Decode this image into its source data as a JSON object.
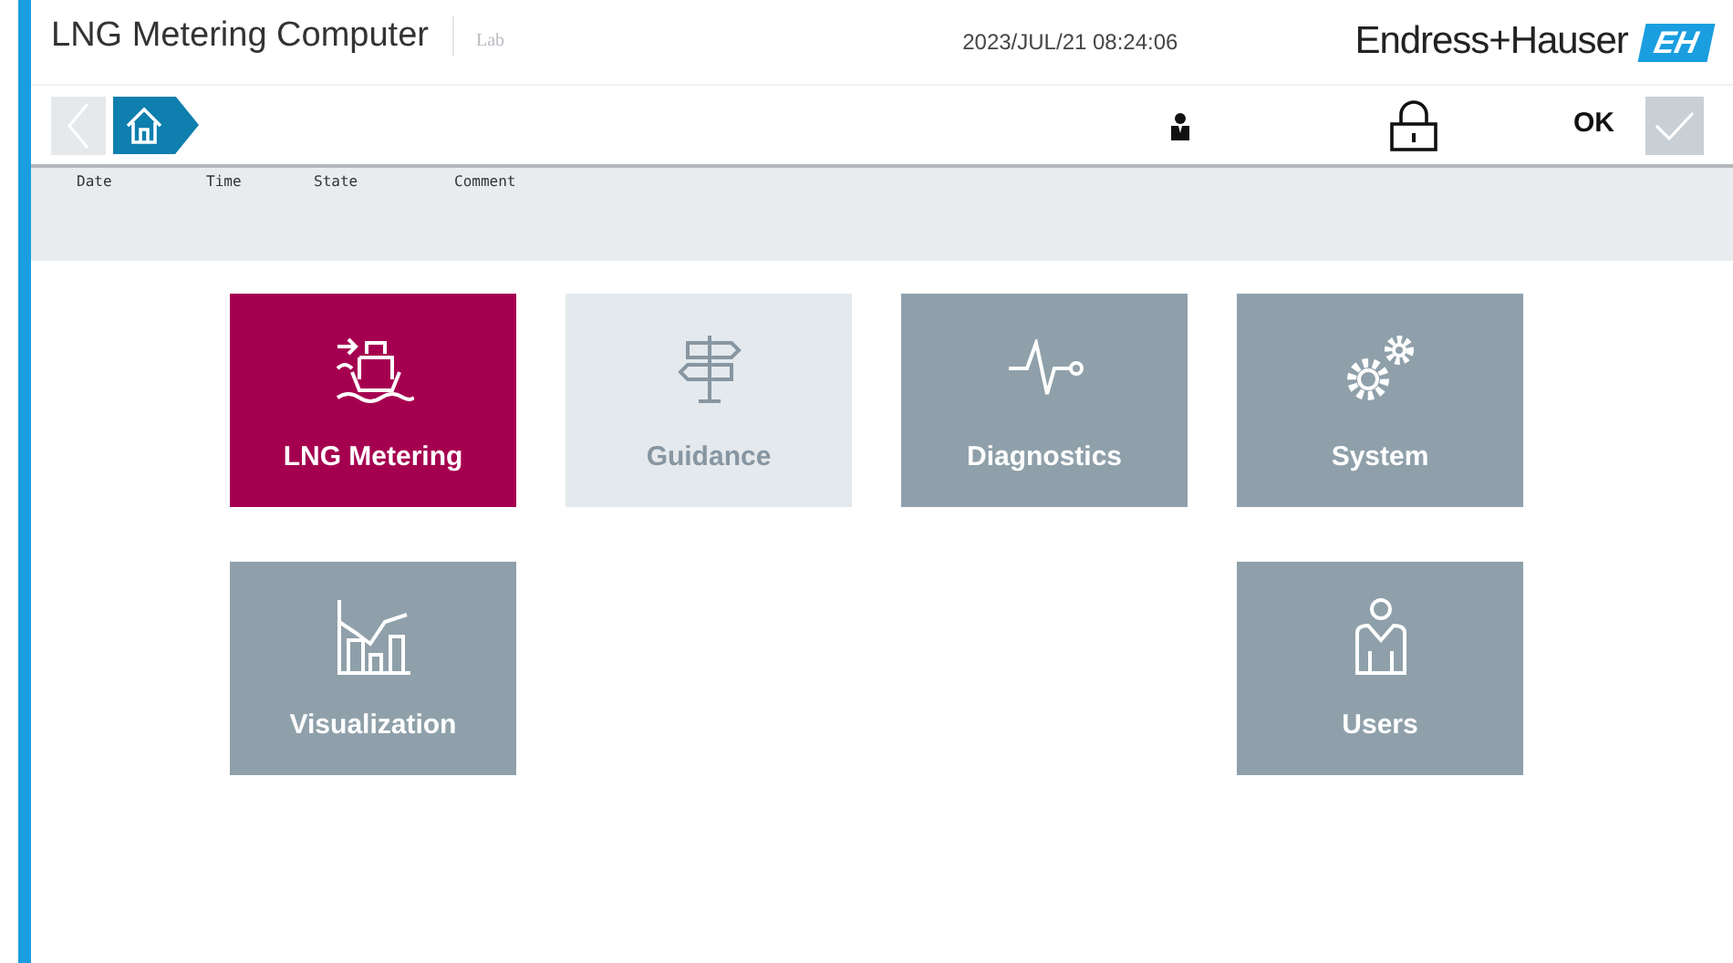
{
  "header": {
    "title": "LNG Metering Computer",
    "subtitle": "Lab",
    "datetime": "2023/JUL/21 08:24:06",
    "brand": "Endress+Hauser",
    "brand_mark": "EH"
  },
  "toolbar": {
    "back_disabled": true,
    "ok_label": "OK",
    "ok_disabled": true
  },
  "event_log": {
    "columns": [
      "Date",
      "Time",
      "State",
      "Comment"
    ]
  },
  "tiles": [
    {
      "label": "LNG Metering",
      "selected": true,
      "disabled": false
    },
    {
      "label": "Guidance",
      "selected": false,
      "disabled": true
    },
    {
      "label": "Diagnostics",
      "selected": false,
      "disabled": false
    },
    {
      "label": "System",
      "selected": false,
      "disabled": false
    },
    {
      "label": "Visualization",
      "selected": false,
      "disabled": false
    },
    {
      "label": "Users",
      "selected": false,
      "disabled": false
    }
  ]
}
